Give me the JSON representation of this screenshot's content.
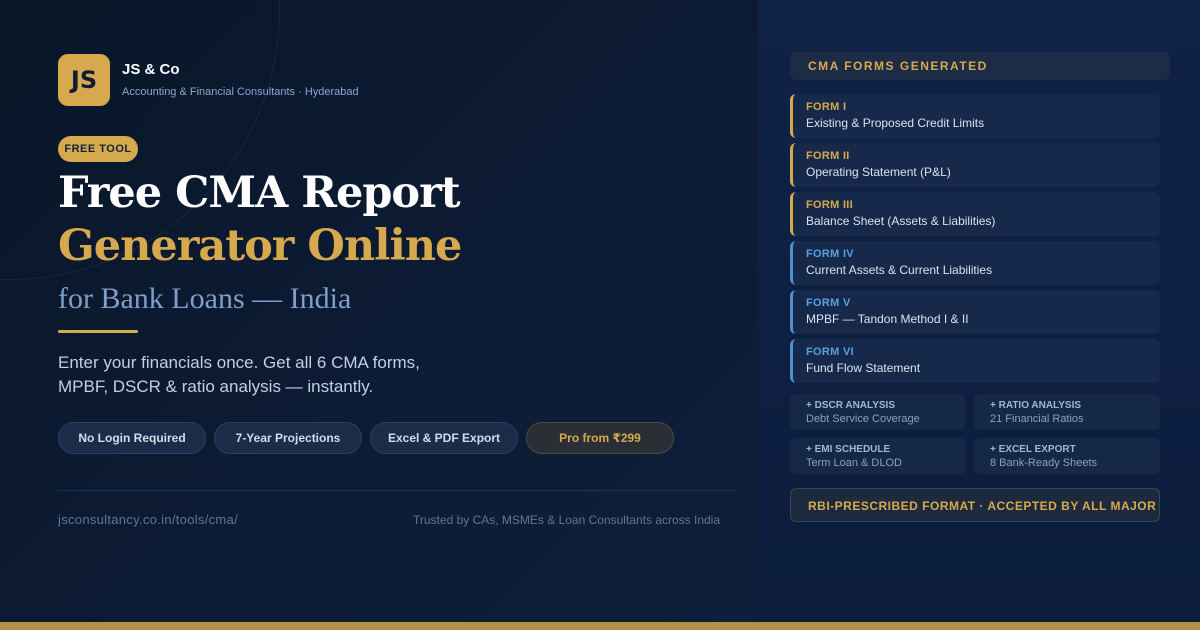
{
  "brand": {
    "logo_text": "JS",
    "name": "JS & Co",
    "tagline": "Accounting & Financial Consultants · Hyderabad"
  },
  "hero": {
    "badge": "FREE TOOL",
    "title_line1": "Free CMA Report",
    "title_line2": "Generator Online",
    "subtitle": "for Bank Loans — India",
    "description_line1": "Enter your financials once. Get all 6 CMA forms,",
    "description_line2": "MPBF, DSCR & ratio analysis — instantly."
  },
  "features": [
    {
      "label": "No Login Required"
    },
    {
      "label": "7-Year Projections"
    },
    {
      "label": "Excel & PDF Export"
    },
    {
      "label": "Pro from ₹299"
    }
  ],
  "footer": {
    "url": "jsconsultancy.co.in/tools/cma/",
    "trust": "Trusted by CAs, MSMEs & Loan Consultants across India"
  },
  "forms_panel": {
    "header": "CMA FORMS GENERATED",
    "forms": [
      {
        "number": "FORM I",
        "description": "Existing & Proposed Credit Limits"
      },
      {
        "number": "FORM II",
        "description": "Operating Statement (P&L)"
      },
      {
        "number": "FORM III",
        "description": "Balance Sheet (Assets & Liabilities)"
      },
      {
        "number": "FORM IV",
        "description": "Current Assets & Current Liabilities"
      },
      {
        "number": "FORM V",
        "description": "MPBF — Tandon Method I & II"
      },
      {
        "number": "FORM VI",
        "description": "Fund Flow Statement"
      }
    ],
    "extras": [
      {
        "title": "+ DSCR ANALYSIS",
        "subtitle": "Debt Service Coverage"
      },
      {
        "title": "+ RATIO ANALYSIS",
        "subtitle": "21 Financial Ratios"
      },
      {
        "title": "+ EMI SCHEDULE",
        "subtitle": "Term Loan & DLOD"
      },
      {
        "title": "+ EXCEL EXPORT",
        "subtitle": "8 Bank-Ready Sheets"
      }
    ],
    "note": "RBI-PRESCRIBED FORMAT · ACCEPTED BY ALL MAJOR INDIAN BANKS"
  },
  "colors": {
    "gold": "#d6a94e",
    "navy": "#0b1a30",
    "blue_accent": "#4d8fd1"
  }
}
